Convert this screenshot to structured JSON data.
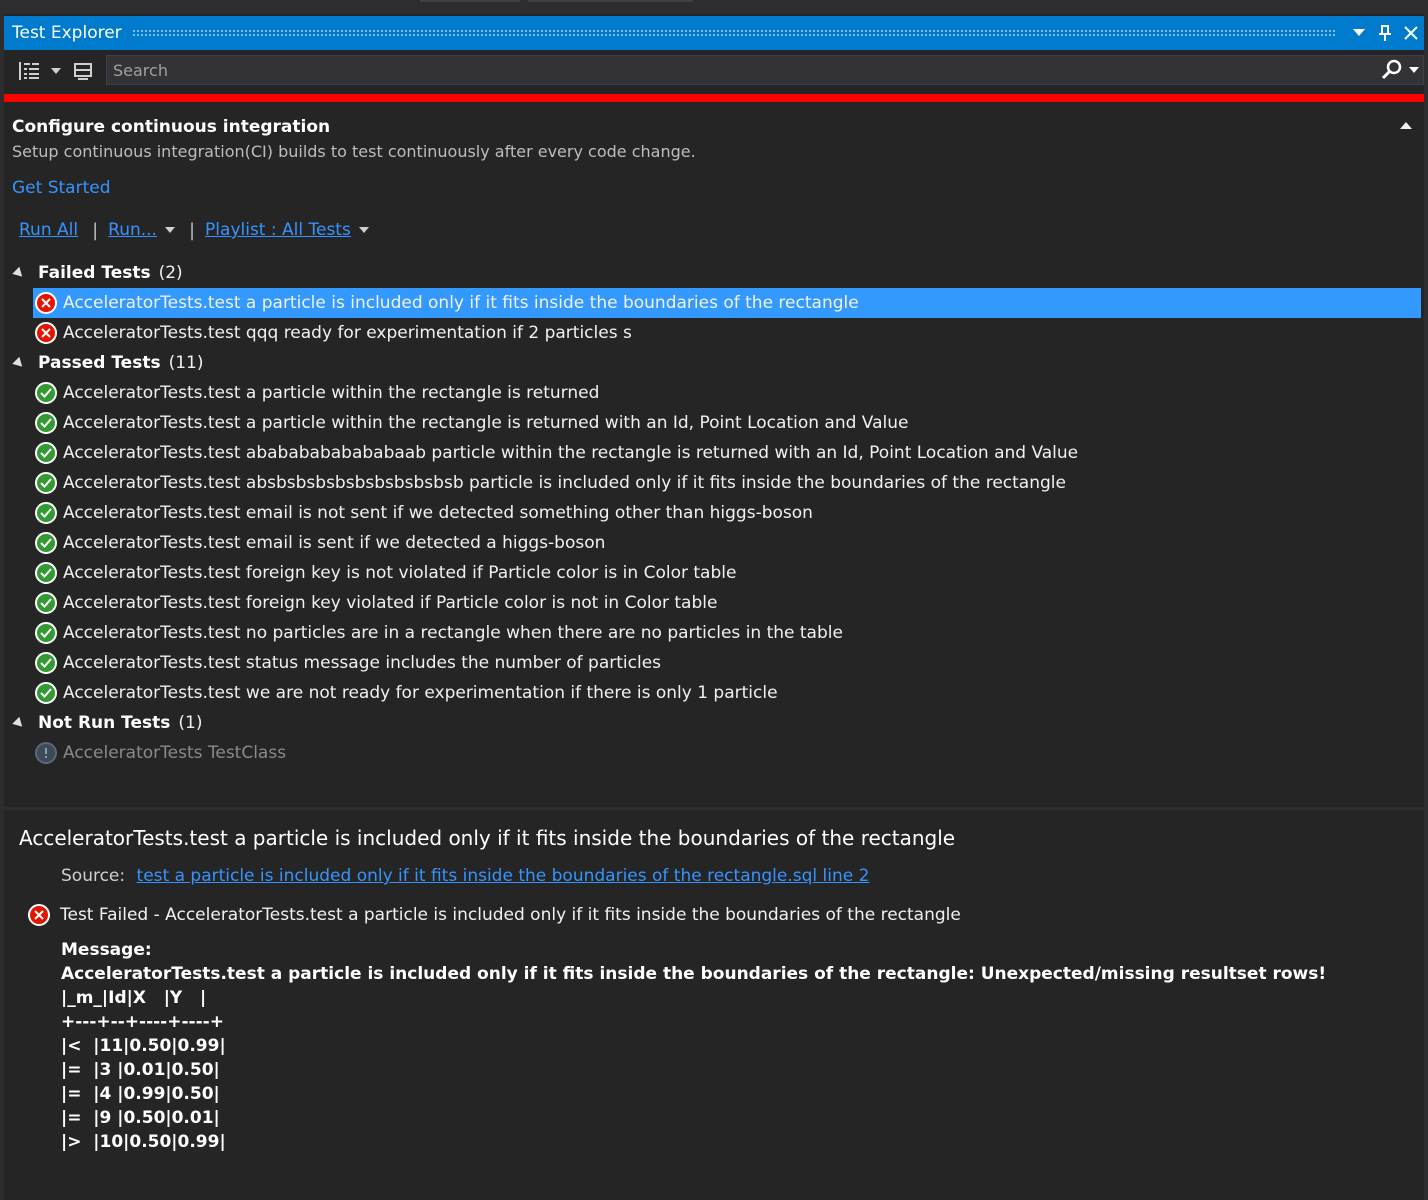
{
  "window": {
    "title": "Test Explorer",
    "accent_color": "#007acc",
    "status_bar_color": "#ff0000"
  },
  "search": {
    "placeholder": "Search"
  },
  "ci_banner": {
    "title": "Configure continuous integration",
    "description": "Setup continuous integration(CI) builds to test continuously after every code change.",
    "link": "Get Started"
  },
  "run_bar": {
    "run_all": "Run All",
    "run": "Run...",
    "playlist": "Playlist : All Tests"
  },
  "groups": {
    "failed": {
      "name": "Failed Tests",
      "count": "(2)",
      "tests": [
        "AcceleratorTests.test a particle is included only if it fits inside the boundaries of the rectangle",
        "AcceleratorTests.test qqq ready for experimentation if 2 particles s"
      ]
    },
    "passed": {
      "name": "Passed Tests",
      "count": "(11)",
      "tests": [
        "AcceleratorTests.test a particle within the rectangle is returned",
        "AcceleratorTests.test a particle within the rectangle is returned with an Id, Point Location and Value",
        "AcceleratorTests.test abababababababaab particle within the rectangle is returned with an Id, Point Location and Value",
        "AcceleratorTests.test absbsbsbsbsbsbsbsbsbsb particle is included only if it fits inside the boundaries of the rectangle",
        "AcceleratorTests.test email is not sent if we detected something other than higgs-boson",
        "AcceleratorTests.test email is sent if we detected a higgs-boson",
        "AcceleratorTests.test foreign key is not violated if Particle color is in Color table",
        "AcceleratorTests.test foreign key violated if Particle color is not in Color table",
        "AcceleratorTests.test no particles are in a rectangle when there are no particles in the table",
        "AcceleratorTests.test status message includes the number of particles",
        "AcceleratorTests.test we are not ready for experimentation if there is only 1 particle"
      ]
    },
    "not_run": {
      "name": "Not Run Tests",
      "count": "(1)",
      "tests": [
        "AcceleratorTests TestClass"
      ]
    }
  },
  "details": {
    "title": "AcceleratorTests.test a particle is included only if it fits inside the boundaries of the rectangle",
    "source_label": "Source:",
    "source_link": "test a particle is included only if it fits inside the boundaries of the rectangle.sql line 2",
    "result": "Test Failed - AcceleratorTests.test a particle is included only if it fits inside the boundaries of the rectangle",
    "message_label": "Message:",
    "message": "AcceleratorTests.test a particle is included only if it fits inside the boundaries of the rectangle: Unexpected/missing resultset rows!\n|_m_|Id|X   |Y   |\n+---+--+----+----+\n|<  |11|0.50|0.99|\n|=  |3 |0.01|0.50|\n|=  |4 |0.99|0.50|\n|=  |9 |0.50|0.01|\n|>  |10|0.50|0.99|"
  },
  "icons": {
    "failed": "error-icon",
    "passed": "check-icon",
    "not_run": "info-icon"
  }
}
